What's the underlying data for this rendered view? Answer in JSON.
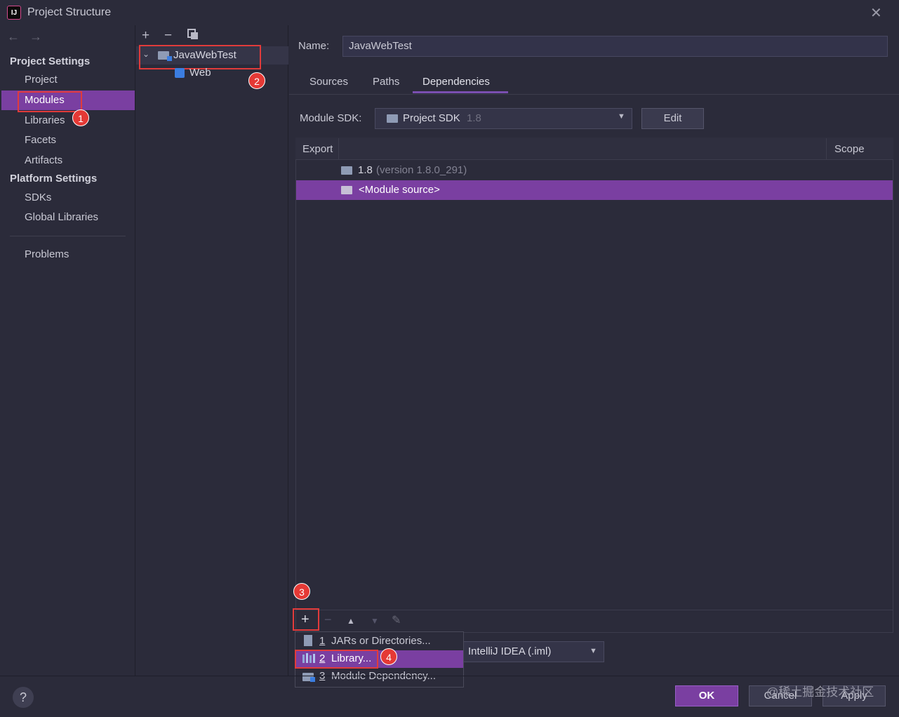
{
  "window": {
    "title": "Project Structure",
    "logo": "IJ"
  },
  "sidebar": {
    "sections": [
      {
        "title": "Project Settings",
        "items": [
          "Project",
          "Modules",
          "Libraries",
          "Facets",
          "Artifacts"
        ]
      },
      {
        "title": "Platform Settings",
        "items": [
          "SDKs",
          "Global Libraries"
        ]
      }
    ],
    "problems": "Problems",
    "selected": "Modules"
  },
  "tree": {
    "module": "JavaWebTest",
    "child": "Web"
  },
  "details": {
    "name_label": "Name:",
    "name_value": "JavaWebTest",
    "tabs": [
      "Sources",
      "Paths",
      "Dependencies"
    ],
    "active_tab": "Dependencies",
    "sdk_label": "Module SDK:",
    "sdk_value": "Project SDK",
    "sdk_version": "1.8",
    "edit_button": "Edit",
    "table": {
      "headers": [
        "Export",
        "Scope"
      ],
      "rows": [
        {
          "name": "1.8",
          "detail": "(version 1.8.0_291)"
        },
        {
          "name": "<Module source>"
        }
      ]
    },
    "format_value": "IntelliJ IDEA (.iml)"
  },
  "popup_menu": [
    {
      "num": "1",
      "label": "JARs or Directories..."
    },
    {
      "num": "2",
      "label": "Library..."
    },
    {
      "num": "3",
      "label": "Module Dependency..."
    }
  ],
  "badges": [
    "1",
    "2",
    "3",
    "4"
  ],
  "footer": {
    "help": "?",
    "ok": "OK",
    "cancel": "Cancel",
    "apply": "Apply",
    "watermark": "@稀土掘金技术社区"
  },
  "colors": {
    "selection": "#7a3fa1",
    "annotation": "#e13b3b",
    "background": "#2b2b3a"
  }
}
